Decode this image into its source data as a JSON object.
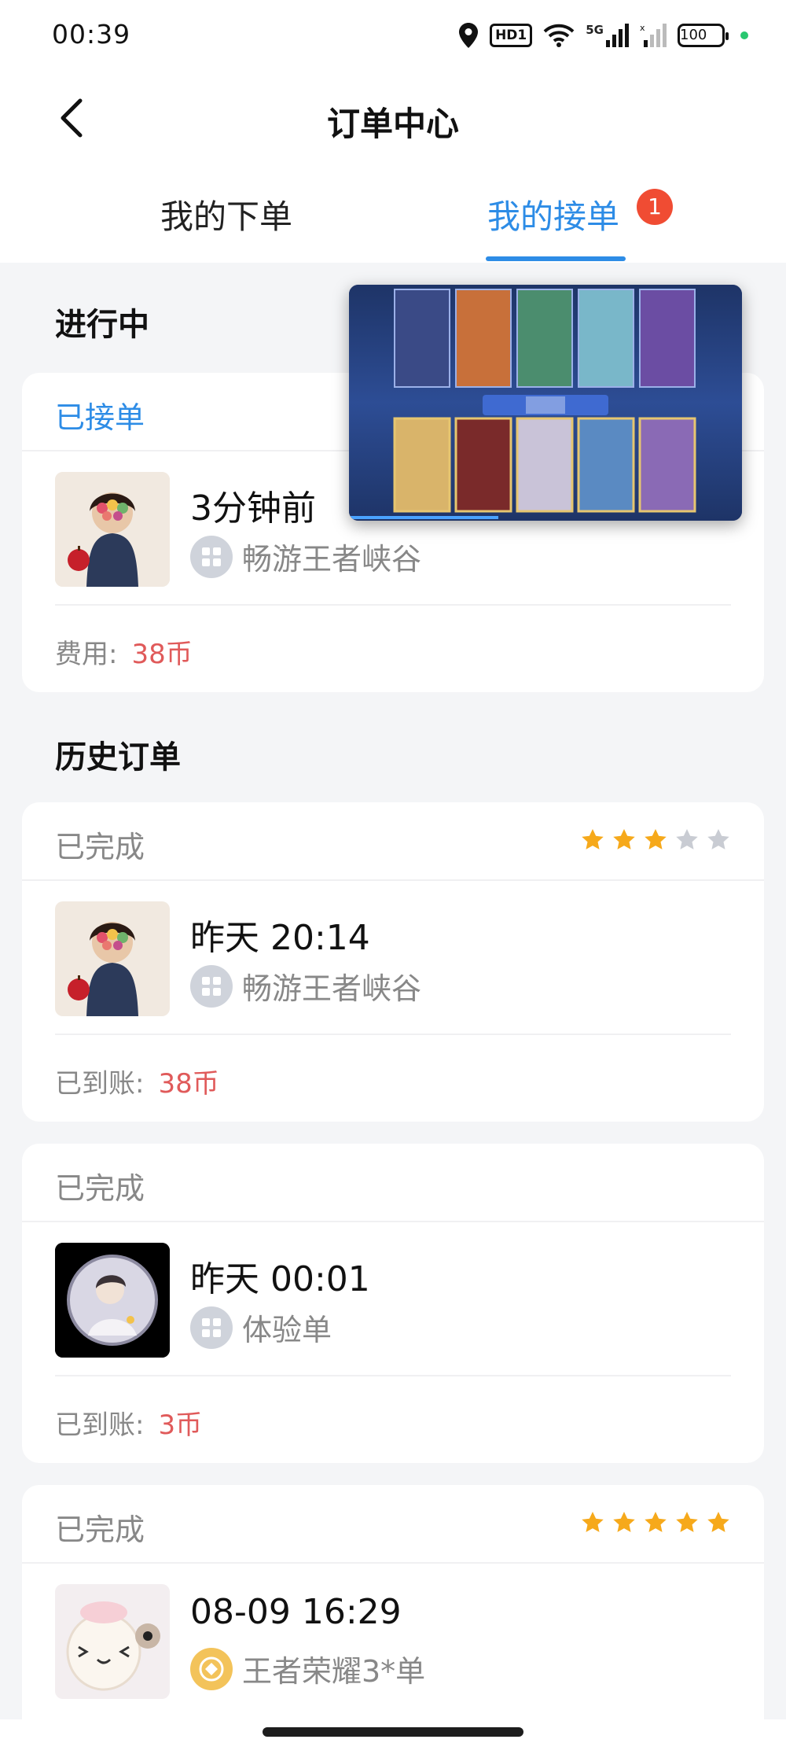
{
  "status_bar": {
    "time": "00:39",
    "hd_label": "HD1",
    "net_label": "5G",
    "battery": "100",
    "icons": [
      "location-icon",
      "wifi-icon",
      "signal-icon",
      "signal-2-icon"
    ]
  },
  "header": {
    "back_icon": "back-arrow-icon",
    "title": "订单中心"
  },
  "tabs": [
    {
      "label": "我的下单",
      "active": false
    },
    {
      "label": "我的接单",
      "active": true,
      "badge": "1"
    }
  ],
  "ongoing": {
    "section_title": "进行中",
    "order": {
      "status": "已接单",
      "time": "3分钟前",
      "game": "畅游王者峡谷",
      "fee_label": "费用:",
      "fee_value": "38币"
    }
  },
  "history": {
    "section_title": "历史订单",
    "orders": [
      {
        "status": "已完成",
        "rating": 3,
        "time": "昨天 20:14",
        "game": "畅游王者峡谷",
        "amount_label": "已到账:",
        "amount": "38币"
      },
      {
        "status": "已完成",
        "time": "昨天 00:01",
        "game": "体验单",
        "amount_label": "已到账:",
        "amount": "3币"
      },
      {
        "status": "已完成",
        "rating": 5,
        "time": "08-09 16:29",
        "game": "王者荣耀3*单"
      }
    ]
  },
  "colors": {
    "accent": "#2d8ce6",
    "price": "#e05a5a",
    "star_on": "#f6a91b",
    "star_off": "#c9ccd3",
    "badge": "#f04c33"
  }
}
